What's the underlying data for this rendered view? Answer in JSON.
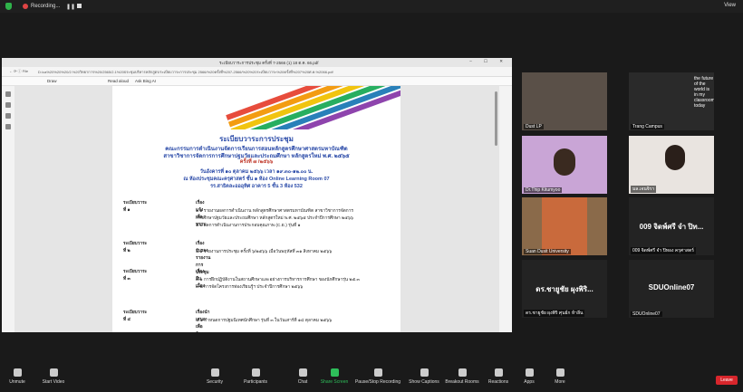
{
  "topbar": {
    "recording": "Recording...",
    "view": "View"
  },
  "browser": {
    "tab_title": "ระเบียบวาระการประชุม ครั้งที่ 7-2566 (1) 18 ต.ค. 66.pdf",
    "address_label": "File",
    "url": "D:/ca%20%20%20/2.%20วิทยาการ%20/2565/2.1%20ประชุมบริหารหลักสูตร/ระเบียบวาระการประชุม 2566/%20ครั้งที่%207-2566/%20%20ระเบียบวาระ%20ครั้งที่%207%20ศ.ค.%2066.pdf",
    "pdf_tools": {
      "draw": "Draw",
      "read_aloud": "Read aloud",
      "ask": "Ask Bing AI"
    }
  },
  "document": {
    "title": "ระเบียบวาระการประชุม",
    "line2": "คณะกรรมการดำเนินงานจัดการเรียนการสอนหลักสูตรศึกษาศาสตรมหาบัณฑิต",
    "line3": "สาขาวิชาการจัดการการศึกษาปฐมวัยและประถมศึกษา หลักสูตรใหม่ พ.ศ. ๒๕๖๕",
    "line4": "ครั้งที่ ๗ /๒๕๖๖",
    "line5": "วันอังคารที่ ๑๐ ตุลาคม ๒๕๖๖ เวลา ๑๙.๓๐-๑๒.๐๐ น.",
    "line6": "ณ ห้องประชุมคณะครุศาสตร์ ชั้น ๑ ห้อง Online Learning Room 07",
    "line7": "รร.สาธิตละอออุทิศ อาคาร 5 ชั้น 3 ห้อง 532",
    "agenda": [
      {
        "no": "ระเบียบวาระที่ ๑",
        "title": "เรื่องแจ้งเพื่อทราบ",
        "lines": [
          "๑.๑ รายงานผลการดำเนินงาน หลักสูตรศึกษาศาสตรมหาบัณฑิต สาขาวิชาการจัดการ",
          "การศึกษาปฐมวัยและประถมศึกษา หลักสูตรใหม่ พ.ศ. ๒๕๖๕ ประจำปีการศึกษา ๒๕๖๖",
          "๑.๒ ผลการดำเนินงานการประกอบคุณภาพ (C.E.) รุ่นที่ ๑"
        ]
      },
      {
        "no": "ระเบียบวาระที่ ๒",
        "title": "เรื่องรับรองรายงานการประชุม",
        "lines": [
          "๒.๑ รายงานการประชุม ครั้งที่ ๖/๒๕๖๖ เมื่อวันพฤหัสที่ ๓๑ สิงหาคม ๒๕๖๖"
        ]
      },
      {
        "no": "ระเบียบวาระที่ ๓",
        "title": "เรื่องสืบเนื่อง",
        "lines": [
          "๓.๑ การฝึกปฏิบัติงานในสถานศึกษาและอย่างการบริหารการศึกษา ของนักศึกษารุ่น ๒๕.๓",
          "๓.๒ การจัดโครงการท่องเรียนรู้ฯ ประจำปีการศึกษา ๒๕๖๖"
        ]
      },
      {
        "no": "ระเบียบวาระที่ ๔",
        "title": "เรื่องนำเสนอเพื่อพิจารณา",
        "lines": [
          "๔.๑ กำหนดการปฐมนิเทศนักศึกษา รุ่นที่ ๓ ในวันเสาร์ที่ ๑๔ ตุลาคม ๒๕๖๖"
        ]
      }
    ]
  },
  "participants": [
    {
      "name": "Dust LP",
      "bg": "#5a5048"
    },
    {
      "name": "Trang Campus",
      "bg": "#2a2a2a",
      "text": "the future of the world is in my classroom today"
    },
    {
      "name": "Dr.Thip Kitumyoo",
      "bg": "#c9a5d6"
    },
    {
      "name": "มล.เจนจิรา",
      "bg": "#e9e4e0"
    },
    {
      "name": "Suan Dusit University",
      "bg": "#8a6a4a"
    },
    {
      "name": "009 จิดพ์ศรี จำ ปิทอง ครุศาสตร์",
      "bg": "#232323",
      "text": "009 จิดพ์ศรี จำ ปิท..."
    },
    {
      "name": "ดร.ชายูชัย ผุงพิริ ศุนย์ก ห้าลีน",
      "bg": "#232323",
      "text": "ดร.ชายูชัย ผุงพิริ..."
    },
    {
      "name": "SDUOnline07",
      "bg": "#232323",
      "text": "SDUOnline07"
    }
  ],
  "toolbar": {
    "unmute": "Unmute",
    "start_video": "Start Video",
    "security": "Security",
    "participants": "Participants",
    "participant_count": "9",
    "chat": "Chat",
    "share_screen": "Share Screen",
    "pause": "Pause/Stop Recording",
    "captions": "Show Captions",
    "breakout": "Breakout Rooms",
    "reactions": "Reactions",
    "apps": "Apps",
    "more": "More",
    "leave": "Leave"
  }
}
